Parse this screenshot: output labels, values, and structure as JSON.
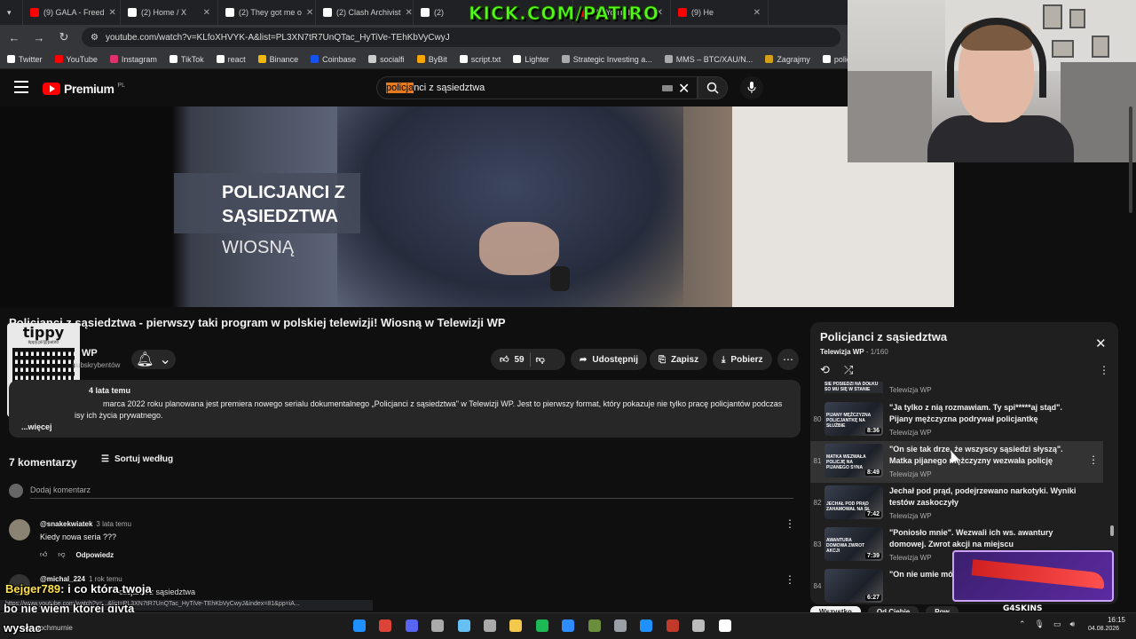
{
  "browser": {
    "tabs": [
      {
        "label": "(9) GALA - Freed",
        "icon_color": "#ff0000"
      },
      {
        "label": "(2) Home / X",
        "icon_color": "#ffffff"
      },
      {
        "label": "(2) They got me o",
        "icon_color": "#ffffff"
      },
      {
        "label": "(2) Clash Archivist",
        "icon_color": "#ffffff"
      },
      {
        "label": "(2)",
        "icon_color": "#ffffff"
      },
      {
        "label": "(9) YouTube",
        "icon_color": "#ff0000"
      },
      {
        "label": "(9) He",
        "icon_color": "#ff0000"
      }
    ],
    "url": "youtube.com/watch?v=KLfoXHVYK-A&list=PL3XN7tR7UnQTac_HyTiVe-TEhKbVyCwyJ",
    "bookmarks": [
      {
        "label": "Twitter",
        "color": "#ffffff"
      },
      {
        "label": "YouTube",
        "color": "#ff0000"
      },
      {
        "label": "Instagram",
        "color": "#e1306c"
      },
      {
        "label": "TikTok",
        "color": "#ffffff"
      },
      {
        "label": "react",
        "color": "#ffffff"
      },
      {
        "label": "Binance",
        "color": "#f0b90b"
      },
      {
        "label": "Coinbase",
        "color": "#1652f0"
      },
      {
        "label": "socialfi",
        "color": "#cccccc"
      },
      {
        "label": "ByBit",
        "color": "#f7a600"
      },
      {
        "label": "script.txt",
        "color": "#ffffff"
      },
      {
        "label": "Lighter",
        "color": "#ffffff"
      },
      {
        "label": "Strategic Investing a...",
        "color": "#aaaaaa"
      },
      {
        "label": "MMS – BTC/XAU/N...",
        "color": "#aaaaaa"
      },
      {
        "label": "Zagrajmy",
        "color": "#d4a017"
      },
      {
        "label": "policja",
        "color": "#ffffff"
      }
    ]
  },
  "overlay": {
    "kick": "KICK.COM/PATIRO",
    "tippy_title": "tippy",
    "tippy_sub": "tippy.pl/@patiro",
    "knife_brand": "G4SKINS"
  },
  "youtube": {
    "logo_word": "Premium",
    "logo_country": "PL",
    "search": {
      "highlight": "policja",
      "rest": "nci z sąsiedztwa"
    },
    "video_card": {
      "line1": "POLICJANCI Z",
      "line2": "SĄSIEDZTWA",
      "line3": "WIOSNĄ"
    },
    "title": "Policjanci z sąsiedztwa - pierwszy taki program w polskiej telewizji! Wiosną w Telewizji WP",
    "channel": "WP",
    "subscribers": "subskrybentów",
    "actions": {
      "likes": "59",
      "share": "Udostępnij",
      "save": "Zapisz",
      "download": "Pobierz"
    },
    "description": {
      "meta": "4 lata temu",
      "text": "marca 2022 roku planowana jest premiera nowego serialu dokumentalnego „Policjanci z sąsiedztwa\" w Telewizji WP. Jest to pierwszy format, który pokazuje nie tylko pracę policjantów podczas",
      "text2": "isy ich życia prywatnego.",
      "more": "...więcej"
    },
    "comments": {
      "count": "7 komentarzy",
      "sort": "Sortuj według",
      "add": "Dodaj komentarz",
      "items": [
        {
          "author": "@snakekwiatek",
          "time": "3 lata temu",
          "text": "Kiedy nowa seria ???",
          "reply": "Odpowiedz"
        },
        {
          "author": "@michal_224",
          "time": "1 rok temu"
        }
      ]
    },
    "hover_tooltip": "olicjanci z sąsiedztwa",
    "status_url": "https://www.youtube.com/watch?v=...&list=PL3XN7tR7UnQTac_HyTiVe-TEhKbVyCwyJ&index=81&pp=iA..."
  },
  "playlist": {
    "title": "Policjanci z sąsiedztwa",
    "channel": "Telewizja WP",
    "position": "1/160",
    "top_channel": "Telewizja WP",
    "top_thumb_text": "SIE POSIEDZI NA DOŁKU SO MU SIĘ W STANIE",
    "items": [
      {
        "num": "80",
        "title": "\"Ja tylko z nią rozmawiam. Ty spi*****aj stąd\". Pijany mężczyzna podrywał policjantkę",
        "channel": "Telewizja WP",
        "duration": "8:36",
        "thumb": "PIJANY MĘŻCZYZNA POLICJANTKĘ NA SŁUŻBIE"
      },
      {
        "num": "81",
        "title": "\"On sie tak drze, że wszyscy sąsiedzi słyszą\". Matka pijanego mężczyzny wezwała policję",
        "channel": "Telewizja WP",
        "duration": "8:49",
        "thumb": "MATKA WEZWAŁA POLICJĘ NA PIJANEGO SYNA"
      },
      {
        "num": "82",
        "title": "Jechał pod prąd, podejrzewano narkotyki. Wyniki testów zaskoczyły",
        "channel": "Telewizja WP",
        "duration": "7:42",
        "thumb": "JECHAŁ POD PRĄD ZAHAMOWAŁ NA SŁ"
      },
      {
        "num": "83",
        "title": "\"Poniosło mnie\". Wezwali ich ws. awantury domowej. Zwrot akcji na miejscu",
        "channel": "Telewizja WP",
        "duration": "7:39",
        "thumb": "AWANTURA DOMOWA ZWROT AKCJI"
      },
      {
        "num": "84",
        "title": "\"On nie umie mó bez dokumentów",
        "channel": "",
        "duration": "6:27",
        "thumb": ""
      }
    ],
    "chips": [
      "Wszystko",
      "Od Ciebie",
      "Pow"
    ]
  },
  "chat": {
    "user": "Bejger789",
    "line1": ": i co która twoja",
    "line2": "bo nie wiem ktorej givta",
    "line3": "wysłac"
  },
  "taskbar": {
    "weather": "pochmurnie",
    "time": "16:15",
    "date": "04.08.2026"
  }
}
